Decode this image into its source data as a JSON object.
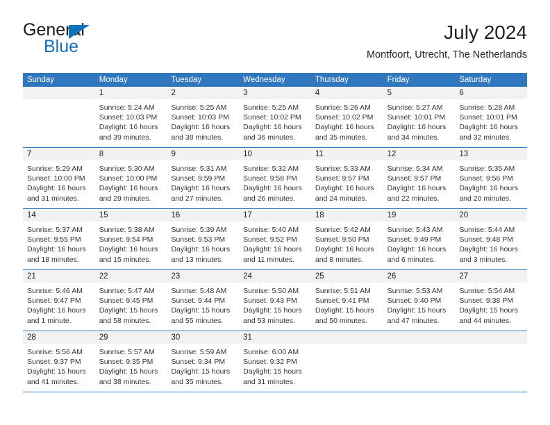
{
  "brand": {
    "name_top": "General",
    "name_bottom": "Blue",
    "triangle_color": "#1271bb",
    "text_color": "#1b1b1b"
  },
  "header": {
    "title": "July 2024",
    "subtitle": "Montfoort, Utrecht, The Netherlands"
  },
  "colors": {
    "header_row_bg": "#3077bd",
    "header_row_text": "#ffffff",
    "day_number_bg": "#f2f2f2",
    "grid_line": "#3077bd",
    "body_text": "#333333"
  },
  "weekdays": [
    "Sunday",
    "Monday",
    "Tuesday",
    "Wednesday",
    "Thursday",
    "Friday",
    "Saturday"
  ],
  "weeks": [
    [
      {
        "day": "",
        "lines": []
      },
      {
        "day": "1",
        "lines": [
          "Sunrise: 5:24 AM",
          "Sunset: 10:03 PM",
          "Daylight: 16 hours",
          "and 39 minutes."
        ]
      },
      {
        "day": "2",
        "lines": [
          "Sunrise: 5:25 AM",
          "Sunset: 10:03 PM",
          "Daylight: 16 hours",
          "and 38 minutes."
        ]
      },
      {
        "day": "3",
        "lines": [
          "Sunrise: 5:25 AM",
          "Sunset: 10:02 PM",
          "Daylight: 16 hours",
          "and 36 minutes."
        ]
      },
      {
        "day": "4",
        "lines": [
          "Sunrise: 5:26 AM",
          "Sunset: 10:02 PM",
          "Daylight: 16 hours",
          "and 35 minutes."
        ]
      },
      {
        "day": "5",
        "lines": [
          "Sunrise: 5:27 AM",
          "Sunset: 10:01 PM",
          "Daylight: 16 hours",
          "and 34 minutes."
        ]
      },
      {
        "day": "6",
        "lines": [
          "Sunrise: 5:28 AM",
          "Sunset: 10:01 PM",
          "Daylight: 16 hours",
          "and 32 minutes."
        ]
      }
    ],
    [
      {
        "day": "7",
        "lines": [
          "Sunrise: 5:29 AM",
          "Sunset: 10:00 PM",
          "Daylight: 16 hours",
          "and 31 minutes."
        ]
      },
      {
        "day": "8",
        "lines": [
          "Sunrise: 5:30 AM",
          "Sunset: 10:00 PM",
          "Daylight: 16 hours",
          "and 29 minutes."
        ]
      },
      {
        "day": "9",
        "lines": [
          "Sunrise: 5:31 AM",
          "Sunset: 9:59 PM",
          "Daylight: 16 hours",
          "and 27 minutes."
        ]
      },
      {
        "day": "10",
        "lines": [
          "Sunrise: 5:32 AM",
          "Sunset: 9:58 PM",
          "Daylight: 16 hours",
          "and 26 minutes."
        ]
      },
      {
        "day": "11",
        "lines": [
          "Sunrise: 5:33 AM",
          "Sunset: 9:57 PM",
          "Daylight: 16 hours",
          "and 24 minutes."
        ]
      },
      {
        "day": "12",
        "lines": [
          "Sunrise: 5:34 AM",
          "Sunset: 9:57 PM",
          "Daylight: 16 hours",
          "and 22 minutes."
        ]
      },
      {
        "day": "13",
        "lines": [
          "Sunrise: 5:35 AM",
          "Sunset: 9:56 PM",
          "Daylight: 16 hours",
          "and 20 minutes."
        ]
      }
    ],
    [
      {
        "day": "14",
        "lines": [
          "Sunrise: 5:37 AM",
          "Sunset: 9:55 PM",
          "Daylight: 16 hours",
          "and 18 minutes."
        ]
      },
      {
        "day": "15",
        "lines": [
          "Sunrise: 5:38 AM",
          "Sunset: 9:54 PM",
          "Daylight: 16 hours",
          "and 15 minutes."
        ]
      },
      {
        "day": "16",
        "lines": [
          "Sunrise: 5:39 AM",
          "Sunset: 9:53 PM",
          "Daylight: 16 hours",
          "and 13 minutes."
        ]
      },
      {
        "day": "17",
        "lines": [
          "Sunrise: 5:40 AM",
          "Sunset: 9:52 PM",
          "Daylight: 16 hours",
          "and 11 minutes."
        ]
      },
      {
        "day": "18",
        "lines": [
          "Sunrise: 5:42 AM",
          "Sunset: 9:50 PM",
          "Daylight: 16 hours",
          "and 8 minutes."
        ]
      },
      {
        "day": "19",
        "lines": [
          "Sunrise: 5:43 AM",
          "Sunset: 9:49 PM",
          "Daylight: 16 hours",
          "and 6 minutes."
        ]
      },
      {
        "day": "20",
        "lines": [
          "Sunrise: 5:44 AM",
          "Sunset: 9:48 PM",
          "Daylight: 16 hours",
          "and 3 minutes."
        ]
      }
    ],
    [
      {
        "day": "21",
        "lines": [
          "Sunrise: 5:46 AM",
          "Sunset: 9:47 PM",
          "Daylight: 16 hours",
          "and 1 minute."
        ]
      },
      {
        "day": "22",
        "lines": [
          "Sunrise: 5:47 AM",
          "Sunset: 9:45 PM",
          "Daylight: 15 hours",
          "and 58 minutes."
        ]
      },
      {
        "day": "23",
        "lines": [
          "Sunrise: 5:48 AM",
          "Sunset: 9:44 PM",
          "Daylight: 15 hours",
          "and 55 minutes."
        ]
      },
      {
        "day": "24",
        "lines": [
          "Sunrise: 5:50 AM",
          "Sunset: 9:43 PM",
          "Daylight: 15 hours",
          "and 53 minutes."
        ]
      },
      {
        "day": "25",
        "lines": [
          "Sunrise: 5:51 AM",
          "Sunset: 9:41 PM",
          "Daylight: 15 hours",
          "and 50 minutes."
        ]
      },
      {
        "day": "26",
        "lines": [
          "Sunrise: 5:53 AM",
          "Sunset: 9:40 PM",
          "Daylight: 15 hours",
          "and 47 minutes."
        ]
      },
      {
        "day": "27",
        "lines": [
          "Sunrise: 5:54 AM",
          "Sunset: 9:38 PM",
          "Daylight: 15 hours",
          "and 44 minutes."
        ]
      }
    ],
    [
      {
        "day": "28",
        "lines": [
          "Sunrise: 5:56 AM",
          "Sunset: 9:37 PM",
          "Daylight: 15 hours",
          "and 41 minutes."
        ]
      },
      {
        "day": "29",
        "lines": [
          "Sunrise: 5:57 AM",
          "Sunset: 9:35 PM",
          "Daylight: 15 hours",
          "and 38 minutes."
        ]
      },
      {
        "day": "30",
        "lines": [
          "Sunrise: 5:59 AM",
          "Sunset: 9:34 PM",
          "Daylight: 15 hours",
          "and 35 minutes."
        ]
      },
      {
        "day": "31",
        "lines": [
          "Sunrise: 6:00 AM",
          "Sunset: 9:32 PM",
          "Daylight: 15 hours",
          "and 31 minutes."
        ]
      },
      {
        "day": "",
        "lines": []
      },
      {
        "day": "",
        "lines": []
      },
      {
        "day": "",
        "lines": []
      }
    ]
  ]
}
